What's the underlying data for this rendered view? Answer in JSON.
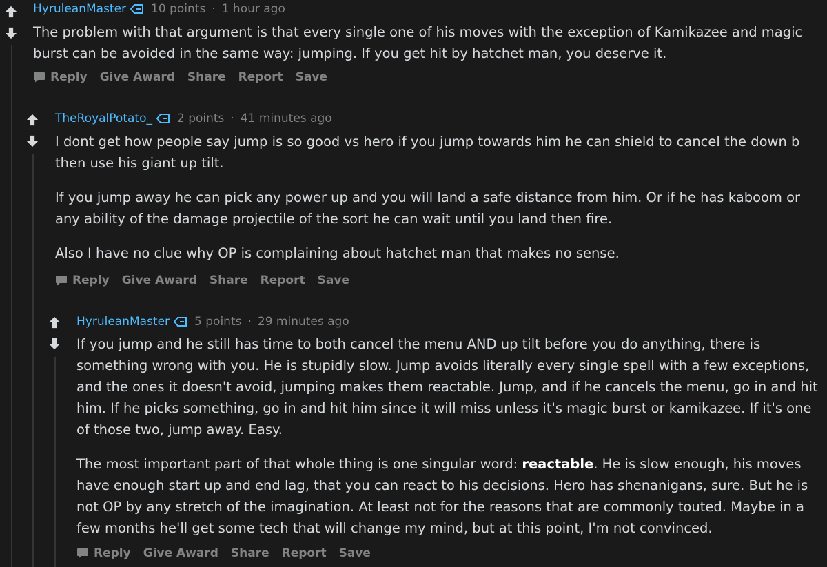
{
  "comments": [
    {
      "author": "HyruleanMaster",
      "points": "10 points",
      "separator": "·",
      "time": "1 hour ago",
      "paragraphs": [
        "The problem with that argument is that every single one of his moves with the exception of Kamikazee and magic burst can be avoided in the same way: jumping. If you get hit by hatchet man, you deserve it."
      ],
      "actions": {
        "reply": "Reply",
        "give_award": "Give Award",
        "share": "Share",
        "report": "Report",
        "save": "Save"
      }
    },
    {
      "author": "TheRoyalPotato_",
      "points": "2 points",
      "separator": "·",
      "time": "41 minutes ago",
      "paragraphs": [
        "I dont get how people say jump is so good vs hero if you jump towards him he can shield to cancel the down b then use his giant up tilt.",
        "If you jump away he can pick any power up and you will land a safe distance from him. Or if he has kaboom or any ability of the damage projectile of the sort he can wait until you land then fire.",
        "Also I have no clue why OP is complaining about hatchet man that makes no sense."
      ],
      "actions": {
        "reply": "Reply",
        "give_award": "Give Award",
        "share": "Share",
        "report": "Report",
        "save": "Save"
      }
    },
    {
      "author": "HyruleanMaster",
      "points": "5 points",
      "separator": "·",
      "time": "29 minutes ago",
      "paragraphs": [
        "If you jump and he still has time to both cancel the menu AND up tilt before you do anything, there is something wrong with you. He is stupidly slow. Jump avoids literally every single spell with a few exceptions, and the ones it doesn't avoid, jumping makes them reactable. Jump, and if he cancels the menu, go in and hit him. If he picks something, go in and hit him since it will miss unless it's magic burst or kamikazee. If it's one of those two, jump away. Easy."
      ],
      "p2_before": "The most important part of that whole thing is one singular word: ",
      "p2_bold": "reactable",
      "p2_after": ". He is slow enough, his moves have enough start up and end lag, that you can react to his decisions. Hero has shenanigans, sure. But he is not OP by any stretch of the imagination. At least not for the reasons that are commonly touted. Maybe in a few months he'll get some tech that will change my mind, but at this point, I'm not convinced.",
      "actions": {
        "reply": "Reply",
        "give_award": "Give Award",
        "share": "Share",
        "report": "Report",
        "save": "Save"
      }
    }
  ],
  "colors": {
    "background": "#1a1a1b",
    "author": "#4fbcff",
    "meta": "#818384",
    "text": "#d7dadc",
    "thread_line": "#343536"
  },
  "icons": [
    "upvote-icon",
    "downvote-icon",
    "flair-icon",
    "comment-bubble-icon"
  ]
}
